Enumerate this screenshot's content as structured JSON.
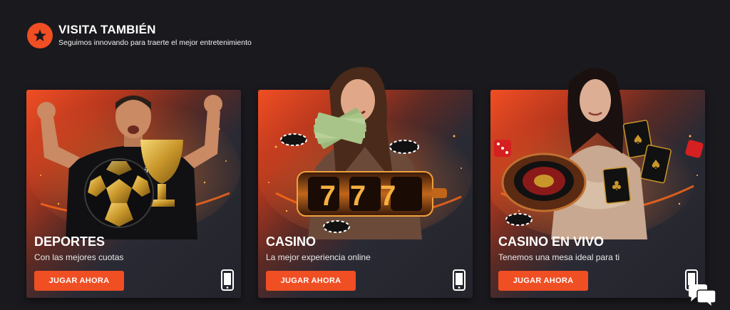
{
  "header": {
    "title": "VISITA TAMBIÉN",
    "subtitle": "Seguimos innovando para traerte el mejor entretenimiento",
    "icon": "star-icon",
    "accent_color": "#f04e23"
  },
  "cards": [
    {
      "title": "DEPORTES",
      "description": "Con las mejores cuotas",
      "button_label": "JUGAR AHORA",
      "image": "soccer-player-with-ball-and-trophy",
      "shirt_text": "JUEGAENLÍNEA",
      "device_icon": "mobile-phone-icon"
    },
    {
      "title": "CASINO",
      "description": "La mejor experiencia online",
      "button_label": "JUGAR AHORA",
      "image": "woman-with-money-and-777-slot-reel",
      "reel_text": "777",
      "device_icon": "mobile-phone-icon"
    },
    {
      "title": "CASINO EN VIVO",
      "description": "Tenemos una mesa ideal para ti",
      "button_label": "JUGAR AHORA",
      "image": "woman-with-roulette-dice-and-cards",
      "device_icon": "mobile-phone-icon"
    }
  ],
  "chat": {
    "icon": "chat-bubbles-icon"
  }
}
